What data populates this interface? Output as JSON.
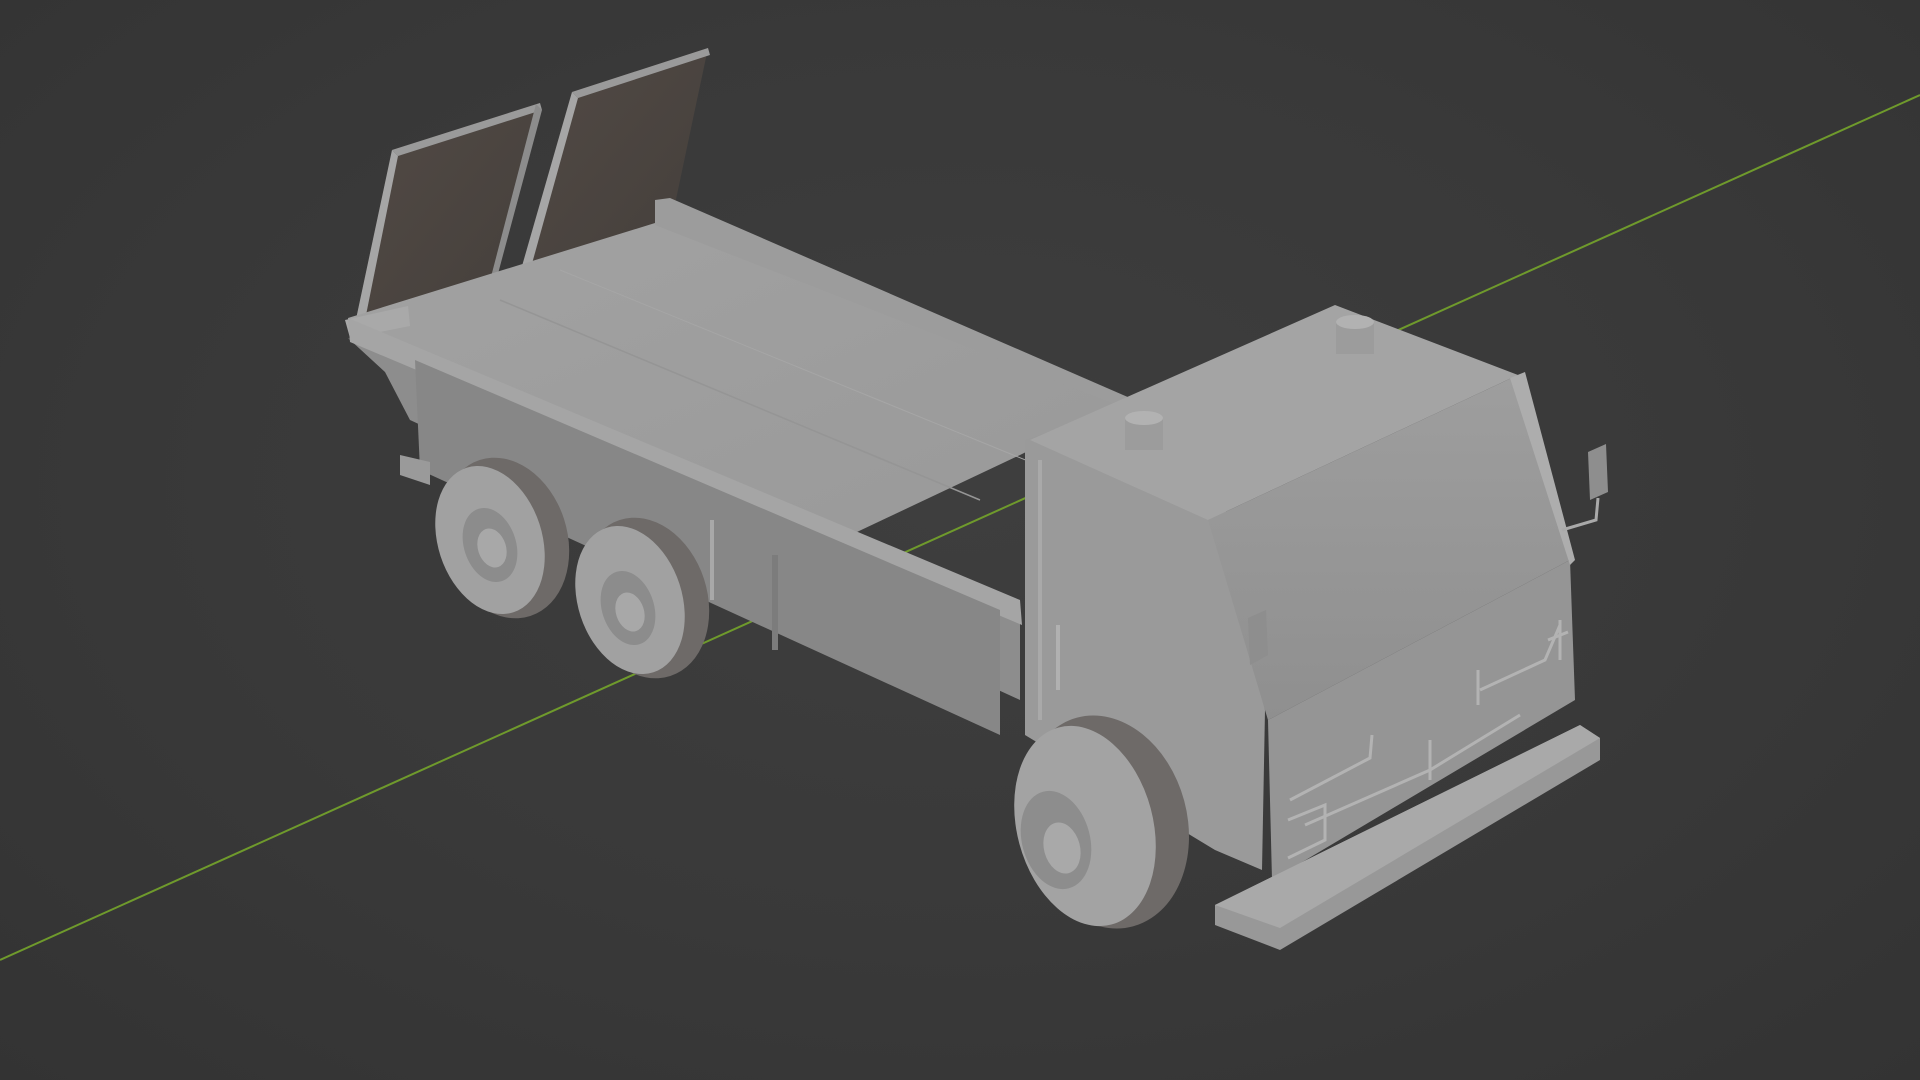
{
  "viewport": {
    "background_color": "#3a3a3a",
    "grid_axis_color": "#6f9a2c",
    "model_color": "#9a9a9a",
    "ramp_color": "#4e4742",
    "shading": "solid"
  },
  "model": {
    "type": "flatbed-truck",
    "parts": [
      "cab",
      "flatbed",
      "loading-ramp-left",
      "loading-ramp-right",
      "front-wheel",
      "rear-wheel-1",
      "rear-wheel-2",
      "side-mirror",
      "front-bumper",
      "roof-lights"
    ]
  }
}
